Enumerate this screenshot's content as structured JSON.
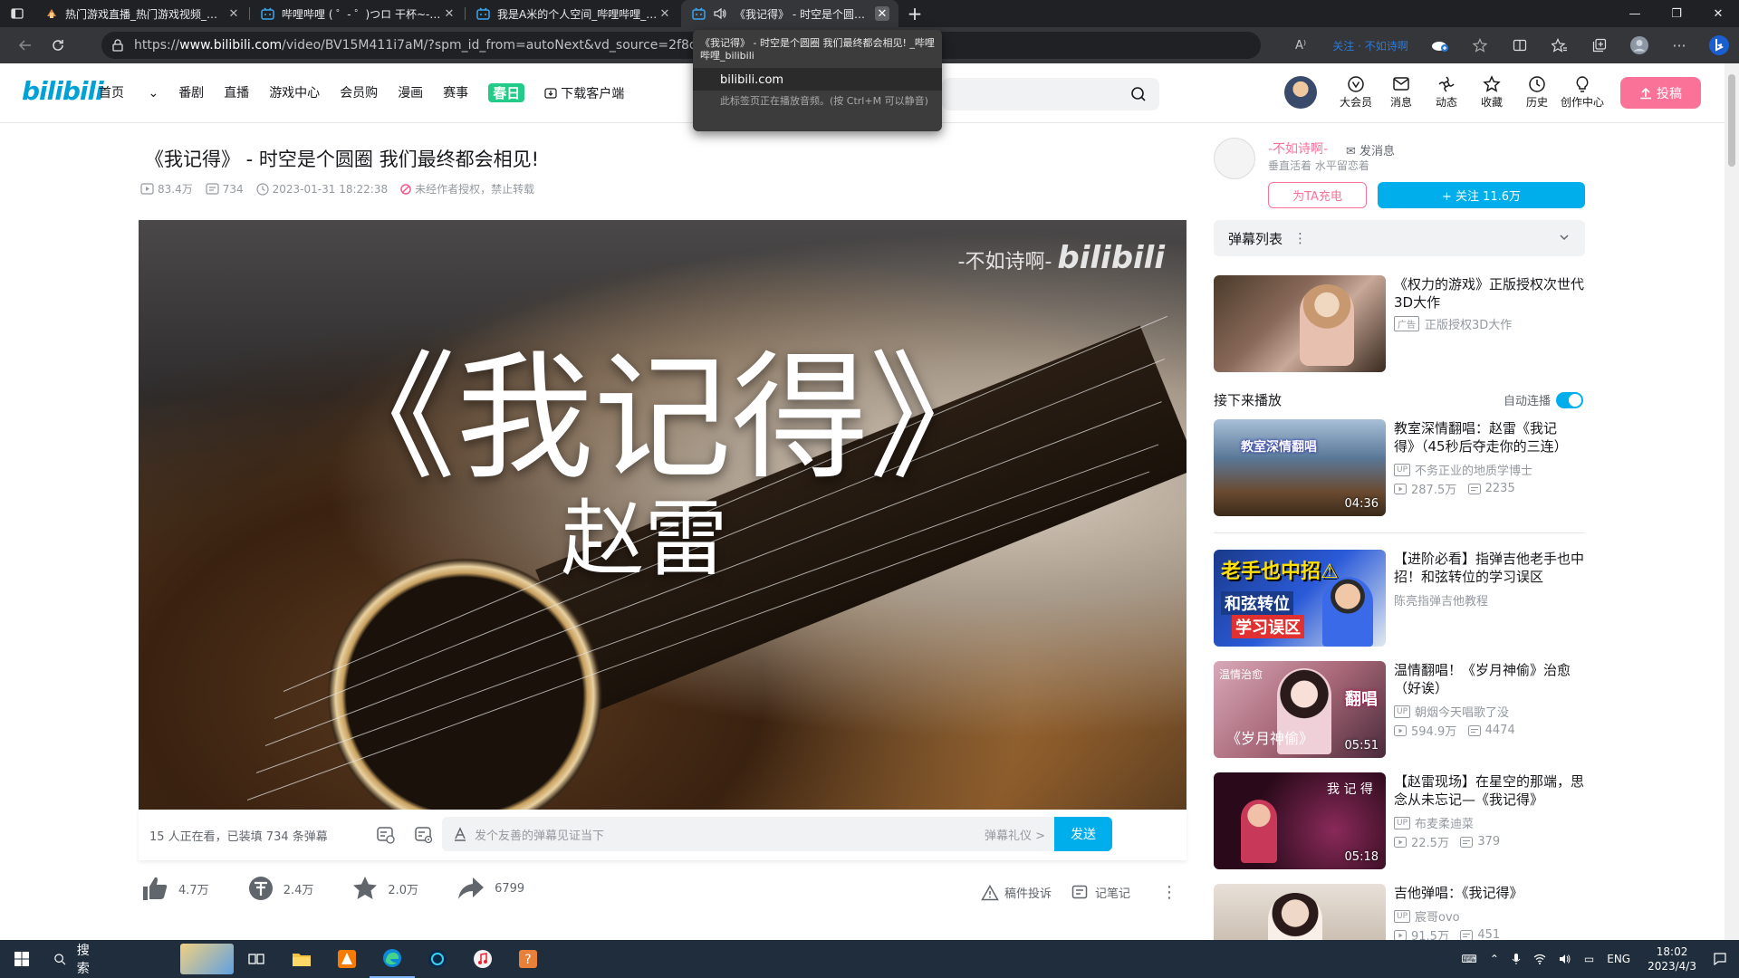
{
  "browser": {
    "tabs": [
      {
        "title": "热门游戏直播_热门游戏视频_热门",
        "icon": "bilibili-tab-icon"
      },
      {
        "title": "哔哩哔哩 ( ゜- ゜)つロ 干杯~-bilibili",
        "icon": "bilibili-tv-icon"
      },
      {
        "title": "我是A米的个人空间_哔哩哔哩_bilibili",
        "icon": "bilibili-tv-icon"
      },
      {
        "title": "《我记得》 - 时空是个圆圈 我们最终都会相见!",
        "icon": "bilibili-tv-icon",
        "audio": true,
        "active": true
      }
    ],
    "url_prefix": "https://",
    "url_domain": "www.bilibili.com",
    "url_rest": "/video/BV15M411i7aM/?spm_id_from=autoNext&vd_source=2f8d96d64e64",
    "tooltip": {
      "title": "《我记得》 - 时空是个圆圈 我们最终都会相见! _哔哩哔哩_bilibili",
      "domain": "bilibili.com",
      "note": "此标签页正在播放音频。(按 Ctrl+M 可以静音)"
    },
    "toolbar_extra": "关注 · 不如诗啊"
  },
  "header": {
    "logo": "bilibili",
    "nav": [
      "首页",
      "番剧",
      "直播",
      "游戏中心",
      "会员购",
      "漫画",
      "赛事",
      "春日",
      "下载客户端"
    ],
    "icons": [
      {
        "label": "大会员",
        "icon": "vip-icon"
      },
      {
        "label": "消息",
        "icon": "message-icon"
      },
      {
        "label": "动态",
        "icon": "dynamic-icon"
      },
      {
        "label": "收藏",
        "icon": "favorite-icon"
      },
      {
        "label": "历史",
        "icon": "history-icon"
      },
      {
        "label": "创作中心",
        "icon": "creator-icon"
      }
    ],
    "upload": "投稿"
  },
  "video": {
    "title": "《我记得》 - 时空是个圆圈 我们最终都会相见!",
    "views": "83.4万",
    "danmaku": "734",
    "date": "2023-01-31 18:22:38",
    "rights": "未经作者授权，禁止转载",
    "poster_title": "《我记得》",
    "poster_artist": "赵雷",
    "watermark_user": "-不如诗啊-",
    "watermark_logo": "bilibili"
  },
  "danmaku_bar": {
    "viewers": "15 人正在看，已装填 734 条弹幕",
    "placeholder": "发个友善的弹幕见证当下",
    "etiquette": "弹幕礼仪 >",
    "send": "发送"
  },
  "actions": {
    "like": "4.7万",
    "coin": "2.4万",
    "favorite": "2.0万",
    "share": "6799",
    "report": "稿件投诉",
    "note": "记笔记"
  },
  "uploader": {
    "name": "-不如诗啊-",
    "message": "发消息",
    "desc": "垂直活着 水平留恋着",
    "charge": "为TA充电",
    "follow": "+ 关注 11.6万"
  },
  "sidebar": {
    "danmaku_list": "弹幕列表",
    "ad": {
      "title": "《权力的游戏》正版授权次世代3D大作",
      "badge": "广告",
      "sub": "正版授权3D大作"
    },
    "next_label": "接下来播放",
    "autoplay": "自动连播",
    "cards": [
      {
        "title": "教室深情翻唱：赵雷《我记得》（45秒后夺走你的三连）",
        "up": "不务正业的地质学博士",
        "views": "287.5万",
        "dm": "2235",
        "dur": "04:36"
      },
      {
        "title": "【进阶必看】指弹吉他老手也中招！和弦转位的学习误区",
        "up": "陈亮指弹吉他教程",
        "views": "",
        "dm": "",
        "dur": ""
      },
      {
        "title": "温情翻唱！《岁月神偷》治愈（好诶）",
        "up": "朝烟今天唱歌了没",
        "views": "594.9万",
        "dm": "4474",
        "dur": "05:51"
      },
      {
        "title": "【赵雷现场】在星空的那端，思念从未忘记—《我记得》",
        "up": "布麦柔迪菜",
        "views": "22.5万",
        "dm": "379",
        "dur": "05:18"
      },
      {
        "title": "吉他弹唱：《我记得》",
        "up": "宸哥ovo",
        "views": "91.5万",
        "dm": "451",
        "dur": ""
      }
    ]
  },
  "taskbar": {
    "search": "搜索",
    "lang": "ENG",
    "time": "18:02",
    "date": "2023/4/3"
  }
}
